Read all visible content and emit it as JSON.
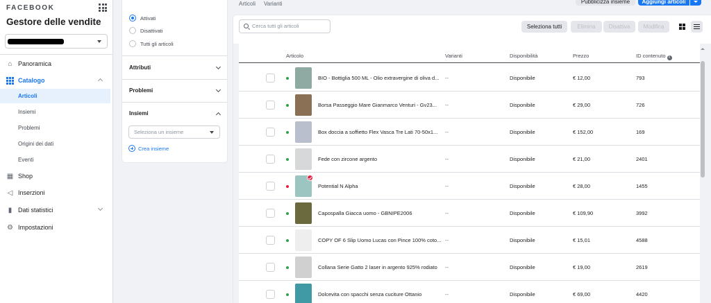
{
  "sidebar": {
    "brand": "FACEBOOK",
    "title": "Gestore delle vendite",
    "nav": [
      {
        "label": "Panoramica"
      },
      {
        "label": "Catalogo"
      },
      {
        "label": "Shop"
      },
      {
        "label": "Inserzioni"
      },
      {
        "label": "Dati statistici"
      },
      {
        "label": "Impostazioni"
      }
    ],
    "catalog_sub": [
      "Articoli",
      "Insiemi",
      "Problemi",
      "Origini dei dati",
      "Eventi"
    ]
  },
  "filters": {
    "status_options": [
      "Attivati",
      "Disattivati",
      "Tutti gli articoli"
    ],
    "sections": [
      "Attributi",
      "Problemi",
      "Insiemi"
    ],
    "set_placeholder": "Seleziona un insieme",
    "create_set": "Crea insieme"
  },
  "tabs": [
    "Articoli",
    "Varianti"
  ],
  "header_buttons": {
    "publish_set": "Pubblicizza insieme",
    "add_items": "Aggiungi articoli"
  },
  "toolbar": {
    "search_placeholder": "Cerca tutti gli articoli",
    "select_all": "Seleziona tutti",
    "delete": "Elimina",
    "deactivate": "Disattiva",
    "edit": "Modifica"
  },
  "table": {
    "columns": [
      "Articolo",
      "Varianti",
      "Disponibilità",
      "Prezzo",
      "ID contenuto"
    ],
    "rows": [
      {
        "name": "BIO - Bottiglia 500 ML - Olio extravergine di oliva d...",
        "variants": "--",
        "availability": "Disponibile",
        "price": "€ 12,00",
        "id": "793",
        "status_color": "#31a24c",
        "thumb_color": "#8fa9a3"
      },
      {
        "name": "Borsa Passeggio Mare Gianmarco Venturi - Gv23...",
        "variants": "--",
        "availability": "Disponibile",
        "price": "€ 29,00",
        "id": "726",
        "status_color": "#31a24c",
        "thumb_color": "#8a7054"
      },
      {
        "name": "Box doccia a soffietto Flex Vasca Tre Lati 70-50x1...",
        "variants": "--",
        "availability": "Disponibile",
        "price": "€ 152,00",
        "id": "169",
        "status_color": "#31a24c",
        "thumb_color": "#b9bfcc"
      },
      {
        "name": "Fede con zircone argento",
        "variants": "--",
        "availability": "Disponibile",
        "price": "€ 21,00",
        "id": "2401",
        "status_color": "#31a24c",
        "thumb_color": "#d6d8da"
      },
      {
        "name": "Potential N Alpha",
        "variants": "--",
        "availability": "Disponibile",
        "price": "€ 28,00",
        "id": "1455",
        "status_color": "#e41e3f",
        "thumb_color": "#9cc5c2"
      },
      {
        "name": "Capospalla Giacca uomo - GBNIPE2006",
        "variants": "--",
        "availability": "Disponibile",
        "price": "€ 109,90",
        "id": "3992",
        "status_color": "#31a24c",
        "thumb_color": "#6b6a3e"
      },
      {
        "name": "COPY OF 6 Slip Uomo Lucas con Pince 100% coto...",
        "variants": "--",
        "availability": "Disponibile",
        "price": "€ 15,01",
        "id": "4588",
        "status_color": "#31a24c",
        "thumb_color": "#eeeeee"
      },
      {
        "name": "Collana Serie Gatto 2 laser in argento 925% rodiato",
        "variants": "--",
        "availability": "Disponibile",
        "price": "€ 19,00",
        "id": "2619",
        "status_color": "#31a24c",
        "thumb_color": "#d0d0d0"
      },
      {
        "name": "Dolcevita con spacchi senza cuciture Ottanio",
        "variants": "--",
        "availability": "Disponibile",
        "price": "€ 69,00",
        "id": "4420",
        "status_color": "#31a24c",
        "thumb_color": "#3f9aa6"
      }
    ]
  }
}
